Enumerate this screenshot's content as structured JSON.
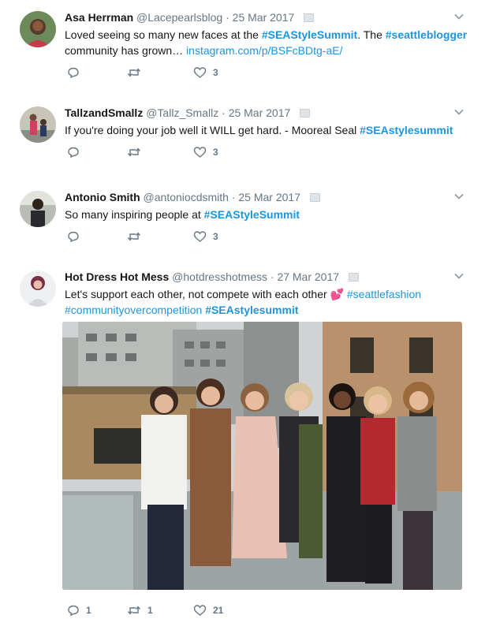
{
  "tweets": [
    {
      "name": "Asa Herrman",
      "handle": "@Lacepearlsblog",
      "date": "25 Mar 2017",
      "text": [
        {
          "t": "text",
          "v": "Loved seeing so many new faces at the "
        },
        {
          "t": "tag",
          "v": "#SEAStyleSummit"
        },
        {
          "t": "text",
          "v": ". The "
        },
        {
          "t": "tag",
          "v": "#seattleblogger"
        },
        {
          "t": "text",
          "v": " community has grown… "
        },
        {
          "t": "link",
          "v": "instagram.com/p/BSFcBDtg-aE/"
        }
      ],
      "reply_count": "",
      "retweet_count": "",
      "like_count": "3"
    },
    {
      "name": "TallzandSmallz",
      "handle": "@Tallz_Smallz",
      "date": "25 Mar 2017",
      "text": [
        {
          "t": "text",
          "v": "If you're doing your job well it WILL get hard. - Mooreal Seal "
        },
        {
          "t": "tag",
          "v": "#SEAstylesummit"
        }
      ],
      "reply_count": "",
      "retweet_count": "",
      "like_count": "3"
    },
    {
      "name": "Antonio Smith",
      "handle": "@antoniocdsmith",
      "date": "25 Mar 2017",
      "text": [
        {
          "t": "text",
          "v": "So many inspiring people at "
        },
        {
          "t": "tag",
          "v": "#SEAStyleSummit"
        }
      ],
      "reply_count": "",
      "retweet_count": "",
      "like_count": "3"
    },
    {
      "name": "Hot Dress Hot Mess",
      "handle": "@hotdresshotmess",
      "date": "27 Mar 2017",
      "text": [
        {
          "t": "text",
          "v": "Let's support each other, not compete with each other "
        },
        {
          "t": "emoji",
          "v": "💕"
        },
        {
          "t": "text",
          "v": " "
        },
        {
          "t": "link",
          "v": "#seattlefashion"
        },
        {
          "t": "text",
          "v": " "
        },
        {
          "t": "link",
          "v": "#communityovercompetition"
        },
        {
          "t": "text",
          "v": " "
        },
        {
          "t": "tag",
          "v": "#SEAstylesummit"
        }
      ],
      "reply_count": "1",
      "retweet_count": "1",
      "like_count": "21"
    }
  ],
  "separator": "·",
  "icons": {
    "reply": "reply-icon",
    "retweet": "retweet-icon",
    "like": "heart-icon",
    "caret": "chevron-down-icon",
    "badge": "card-icon"
  },
  "colors": {
    "link": "#1b95e0",
    "secondary": "#657786",
    "text": "#14171a"
  }
}
